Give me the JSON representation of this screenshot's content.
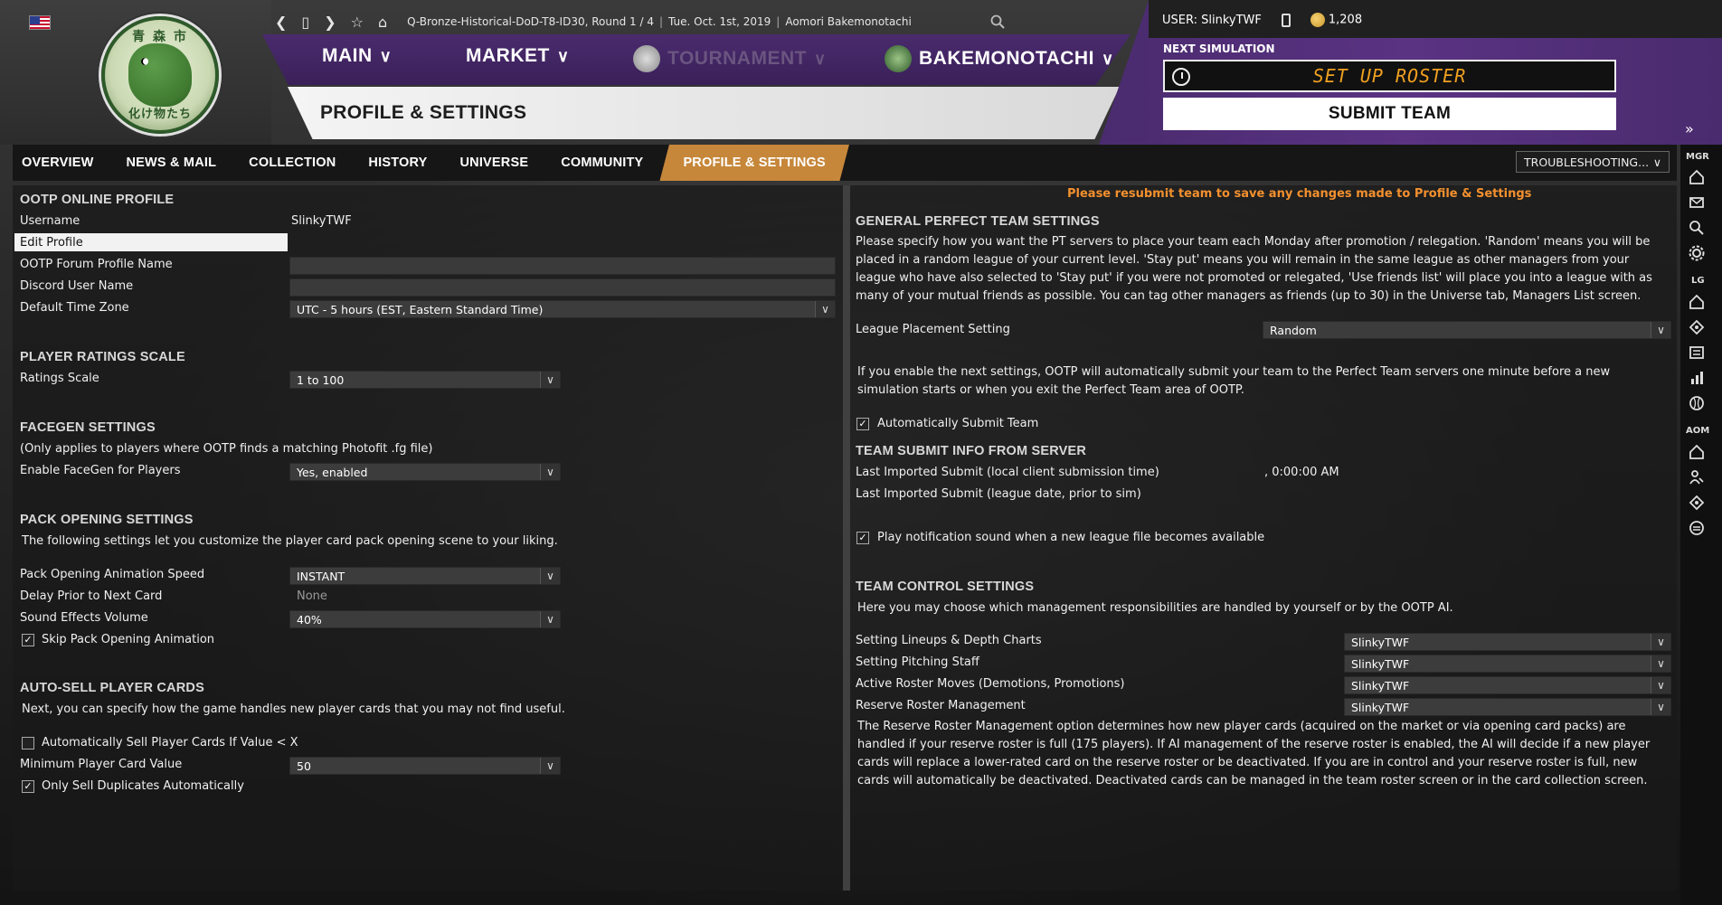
{
  "header": {
    "breadcrumb": [
      "Q-Bronze-Historical-DoD-T8-ID30, Round 1 / 4",
      "Tue. Oct. 1st, 2019",
      "Aomori Bakemonotachi"
    ],
    "logo_top_text": "青 森 市",
    "logo_bottom_text": "化け物たち",
    "user_label": "USER: SlinkyTWF",
    "coins": "1,208",
    "next_sim_label": "NEXT SIMULATION",
    "setup_roster": "SET UP ROSTER",
    "submit_team": "SUBMIT TEAM",
    "page_title": "PROFILE & SETTINGS"
  },
  "main_menu": {
    "main": "MAIN",
    "market": "MARKET",
    "tournament": "TOURNAMENT",
    "team": "BAKEMONOTACHI"
  },
  "tabs": [
    "OVERVIEW",
    "NEWS & MAIL",
    "COLLECTION",
    "HISTORY",
    "UNIVERSE",
    "COMMUNITY",
    "PROFILE & SETTINGS"
  ],
  "troubleshooting": "TROUBLESHOOTING...",
  "left": {
    "online_profile": {
      "title": "OOTP ONLINE PROFILE",
      "username_label": "Username",
      "username_value": "SlinkyTWF",
      "edit_profile": "Edit Profile",
      "forum_name_label": "OOTP Forum Profile Name",
      "discord_label": "Discord User Name",
      "timezone_label": "Default Time Zone",
      "timezone_value": "UTC - 5 hours (EST, Eastern Standard Time)"
    },
    "ratings": {
      "title": "PLAYER RATINGS SCALE",
      "scale_label": "Ratings Scale",
      "scale_value": "1 to 100"
    },
    "facegen": {
      "title": "FACEGEN SETTINGS",
      "note": "(Only applies to players where OOTP finds a matching Photofit .fg file)",
      "enable_label": "Enable FaceGen for Players",
      "enable_value": "Yes, enabled"
    },
    "pack": {
      "title": "PACK OPENING SETTINGS",
      "desc": "The following settings let you customize the player card pack opening scene to your liking.",
      "speed_label": "Pack Opening Animation Speed",
      "speed_value": "INSTANT",
      "delay_label": "Delay Prior to Next Card",
      "delay_value": "None",
      "volume_label": "Sound Effects Volume",
      "volume_value": "40%",
      "skip_label": "Skip Pack Opening Animation"
    },
    "autosell": {
      "title": "AUTO-SELL PLAYER CARDS",
      "desc": "Next, you can specify how the game handles new player cards that you may not find useful.",
      "auto_label": "Automatically Sell Player Cards If Value < X",
      "min_label": "Minimum Player Card Value",
      "min_value": "50",
      "dup_label": "Only Sell Duplicates Automatically"
    }
  },
  "right": {
    "notice": "Please resubmit team to save any changes made to Profile & Settings",
    "general": {
      "title": "GENERAL PERFECT TEAM SETTINGS",
      "desc": "Please specify how you want the PT servers to place your team each Monday after promotion / relegation. 'Random' means you will be placed in a random league of your current level. 'Stay put' means you will remain in the same league as other managers from your league who have also selected to 'Stay put' if you were not promoted or relegated, 'Use friends list' will place you into a league with as many of your mutual friends as possible. You can tag other managers as friends (up to 30) in the Universe tab, Managers List screen.",
      "placement_label": "League Placement Setting",
      "placement_value": "Random",
      "auto_desc": "If you enable the next settings, OOTP will automatically submit your team to the Perfect Team servers one minute before a new simulation starts or when you exit the Perfect Team area of OOTP.",
      "auto_submit_label": "Automatically Submit Team"
    },
    "submit_info": {
      "title": "TEAM SUBMIT INFO FROM SERVER",
      "last_local_label": "Last Imported Submit (local client submission time)",
      "last_local_value": ", 0:00:00 AM",
      "last_league_label": "Last Imported Submit (league date, prior to sim)",
      "sound_label": "Play notification sound when a new league file becomes available"
    },
    "control": {
      "title": "TEAM CONTROL SETTINGS",
      "desc": "Here you may choose which management responsibilities are handled by yourself or by the OOTP AI.",
      "rows": [
        {
          "label": "Setting Lineups & Depth Charts",
          "value": "SlinkyTWF"
        },
        {
          "label": "Setting Pitching Staff",
          "value": "SlinkyTWF"
        },
        {
          "label": "Active Roster Moves (Demotions, Promotions)",
          "value": "SlinkyTWF"
        },
        {
          "label": "Reserve Roster Management",
          "value": "SlinkyTWF"
        }
      ],
      "reserve_desc": "The Reserve Roster Management option determines how new player cards (acquired on the market or via opening card packs) are handled if your reserve roster is full (175 players). If AI management of the reserve roster is enabled, the AI will decide if a new player cards will replace a lower-rated card on the reserve roster or be deactivated. If you are in control and your reserve roster is full, new cards will automatically be deactivated. Deactivated cards can be managed in the team roster screen or in the card collection screen."
    }
  },
  "sidebar": {
    "mgr": "MGR",
    "lg": "LG",
    "aom": "AOM"
  }
}
